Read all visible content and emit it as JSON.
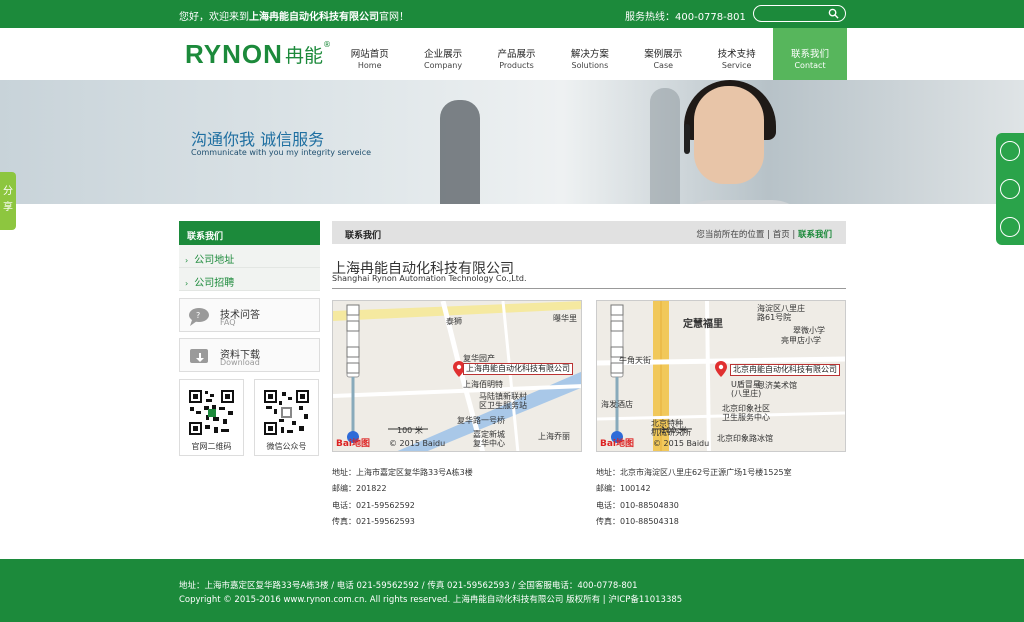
{
  "topbar": {
    "welcome_prefix": "您好，欢迎来到",
    "welcome_company": "上海冉能自动化科技有限公司",
    "welcome_suffix": "官网！",
    "hotline": "服务热线：400-0778-801",
    "search_placeholder": ""
  },
  "logo": {
    "latin": "RYNON",
    "cn": "冉能",
    "reg": "®"
  },
  "nav": {
    "items": [
      {
        "cn": "网站首页",
        "en": "Home"
      },
      {
        "cn": "企业展示",
        "en": "Company"
      },
      {
        "cn": "产品展示",
        "en": "Products"
      },
      {
        "cn": "解决方案",
        "en": "Solutions"
      },
      {
        "cn": "案例展示",
        "en": "Case"
      },
      {
        "cn": "技术支持",
        "en": "Service"
      },
      {
        "cn": "联系我们",
        "en": "Contact"
      }
    ],
    "active_index": 6
  },
  "banner": {
    "title": "沟通你我  诚信服务",
    "subtitle": "Communicate with you my integrity serveice"
  },
  "share": {
    "label": "分享"
  },
  "sidebar": {
    "heading": "联系我们",
    "items": [
      {
        "label": "公司地址"
      },
      {
        "label": "公司招聘"
      }
    ],
    "faq": {
      "cn": "技术问答",
      "en": "FAQ"
    },
    "download": {
      "cn": "资料下载",
      "en": "Download"
    },
    "qr_site": "官网二维码",
    "qr_wechat": "微信公众号"
  },
  "crumb": {
    "title": "联系我们",
    "location_prefix": "您当前所在的位置",
    "home": "首页",
    "current": "联系我们",
    "sep": "|"
  },
  "company": {
    "name": "上海冉能自动化科技有限公司",
    "name_en": "Shanghai Rynon Automation Technology Co.,Ltd."
  },
  "maps": [
    {
      "popup": "上海冉能自动化科技有限公司",
      "labels": [
        "泰狮",
        "曝华里",
        "复华园产",
        "上海佰明特",
        "马陆镇新联村",
        "区卫生服务站",
        "复华路一号桥",
        "嘉定新城",
        "复华中心",
        "上海乔丽"
      ],
      "scale": "100 米",
      "copyright": "© 2015 Baidu",
      "brand": "Bai地图"
    },
    {
      "popup": "北京冉能自动化科技有限公司",
      "labels": [
        "海淀区八里庄",
        "路61号院",
        "定慧福里",
        "北京市",
        "翠微小学",
        "亮甲店小学",
        "U盾冒星",
        "(八里庄)",
        "恩济美术馆",
        "北京印象社区",
        "卫生服务中心",
        "北京特种",
        "机械研究所",
        "北京印象路冰馆",
        "牛角天街",
        "海发酒店"
      ],
      "scale": "100 米",
      "copyright": "© 2015 Baidu",
      "brand": "Bai地图"
    }
  ],
  "contacts": [
    {
      "address": "地址：上海市嘉定区复华路33号A栋3楼",
      "postcode": "邮编：201822",
      "phone": "电话：021-59562592",
      "fax": "传真：021-59562593"
    },
    {
      "address": "地址：北京市海淀区八里庄62号正源广场1号楼1525室",
      "postcode": "邮编：100142",
      "phone": "电话：010-88504830",
      "fax": "传真：010-88504318"
    }
  ],
  "footer": {
    "line1": "地址：上海市嘉定区复华路33号A栋3楼 / 电话 021-59562592 / 传真 021-59562593 / 全国客服电话：400-0778-801",
    "line2": "Copyright © 2015-2016 www.rynon.com.cn. All rights reserved. 上海冉能自动化科技有限公司 版权所有  |  沪ICP备11013385"
  },
  "colors": {
    "brand_green": "#1c8a3b",
    "active_green": "#57b65c",
    "share_green": "#8dc63f"
  }
}
